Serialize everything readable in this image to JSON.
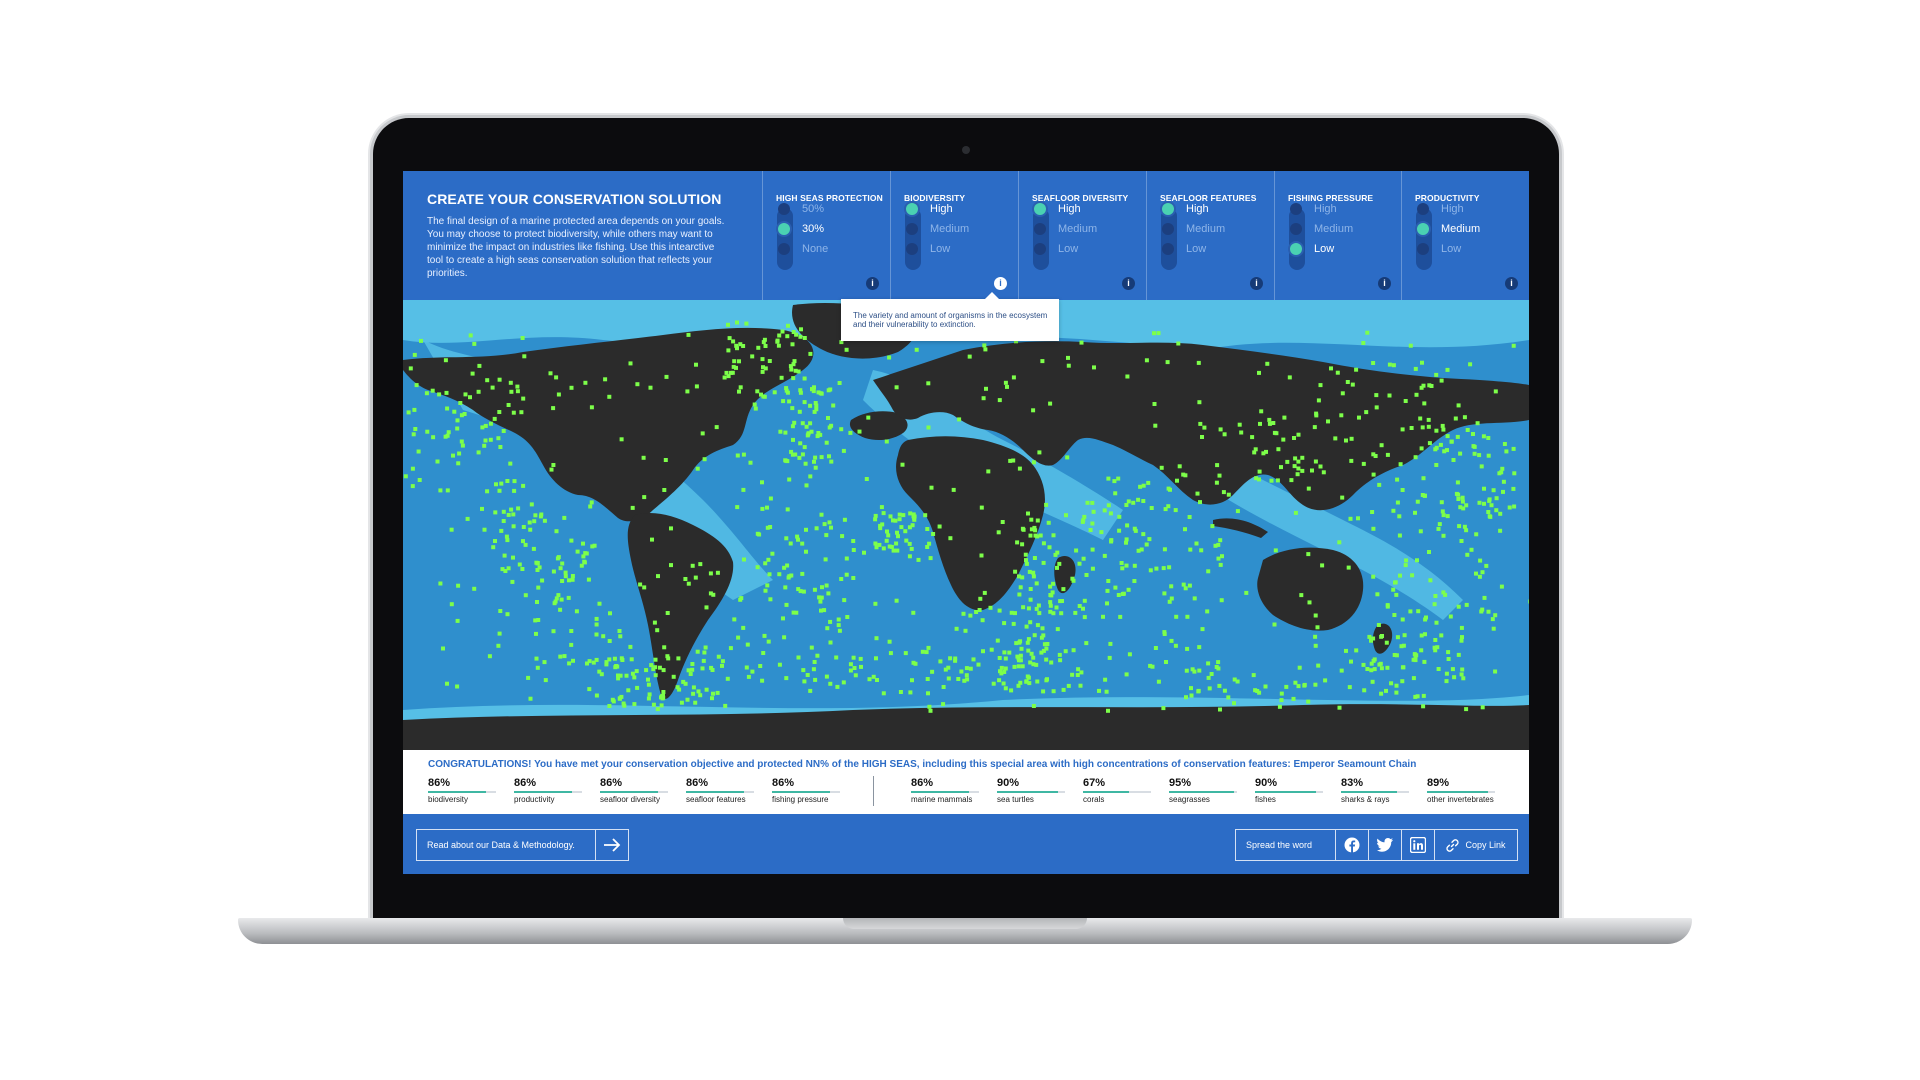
{
  "header": {
    "title": "CREATE YOUR CONSERVATION SOLUTION",
    "description": "The final design of a marine protected area depends on your goals. You may choose to protect biodiversity, while others may want to minimize the impact on industries like fishing. Use this intearctive tool to create a high seas conservation solution that reflects your priorities."
  },
  "filters": [
    {
      "title": "HIGH SEAS PROTECTION",
      "options": [
        "50%",
        "30%",
        "None"
      ],
      "selected": "30%"
    },
    {
      "title": "BIODIVERSITY",
      "options": [
        "High",
        "Medium",
        "Low"
      ],
      "selected": "High"
    },
    {
      "title": "SEAFLOOR DIVERSITY",
      "options": [
        "High",
        "Medium",
        "Low"
      ],
      "selected": "High"
    },
    {
      "title": "SEAFLOOR FEATURES",
      "options": [
        "High",
        "Medium",
        "Low"
      ],
      "selected": "High"
    },
    {
      "title": "FISHING PRESSURE",
      "options": [
        "High",
        "Medium",
        "Low"
      ],
      "selected": "Low"
    },
    {
      "title": "PRODUCTIVITY",
      "options": [
        "High",
        "Medium",
        "Low"
      ],
      "selected": "Medium"
    }
  ],
  "info_icon": "i",
  "tooltip": {
    "text": "The variety and amount of organisms in the ecosystem and their vulnerability to extinction."
  },
  "stats": {
    "message": "CONGRATULATIONS! You have met your conservation objective and protected NN% of the HIGH SEAS, including this special area with high concentrations of conservation features: Emperor Seamount Chain",
    "objectives": [
      {
        "value": "86%",
        "label": "biodiversity",
        "level": 0.86
      },
      {
        "value": "86%",
        "label": "productivity",
        "level": 0.86
      },
      {
        "value": "86%",
        "label": "seafloor diversity",
        "level": 0.86
      },
      {
        "value": "86%",
        "label": "seafloor features",
        "level": 0.86
      },
      {
        "value": "86%",
        "label": "fishing pressure",
        "level": 0.86
      }
    ],
    "features": [
      {
        "value": "86%",
        "label": "marine mammals",
        "level": 0.86
      },
      {
        "value": "90%",
        "label": "sea turtles",
        "level": 0.9
      },
      {
        "value": "67%",
        "label": "corals",
        "level": 0.67
      },
      {
        "value": "95%",
        "label": "seagrasses",
        "level": 0.95
      },
      {
        "value": "90%",
        "label": "fishes",
        "level": 0.9
      },
      {
        "value": "83%",
        "label": "sharks & rays",
        "level": 0.83
      },
      {
        "value": "89%",
        "label": "other invertebrates",
        "level": 0.89
      }
    ]
  },
  "footer": {
    "methodology_label": "Read about our Data & Methodology.",
    "spread_label": "Spread the word",
    "copy_label": "Copy Link",
    "social": [
      "facebook-icon",
      "twitter-icon",
      "linkedin-icon"
    ]
  },
  "colors": {
    "brand_blue": "#2c6cc6",
    "land": "#2b2b2b",
    "ocean_deep": "#2f8fcd",
    "ocean_shelf": "#5ac4e8",
    "protected": "#7dff4a",
    "accent": "#4ad1b2"
  }
}
